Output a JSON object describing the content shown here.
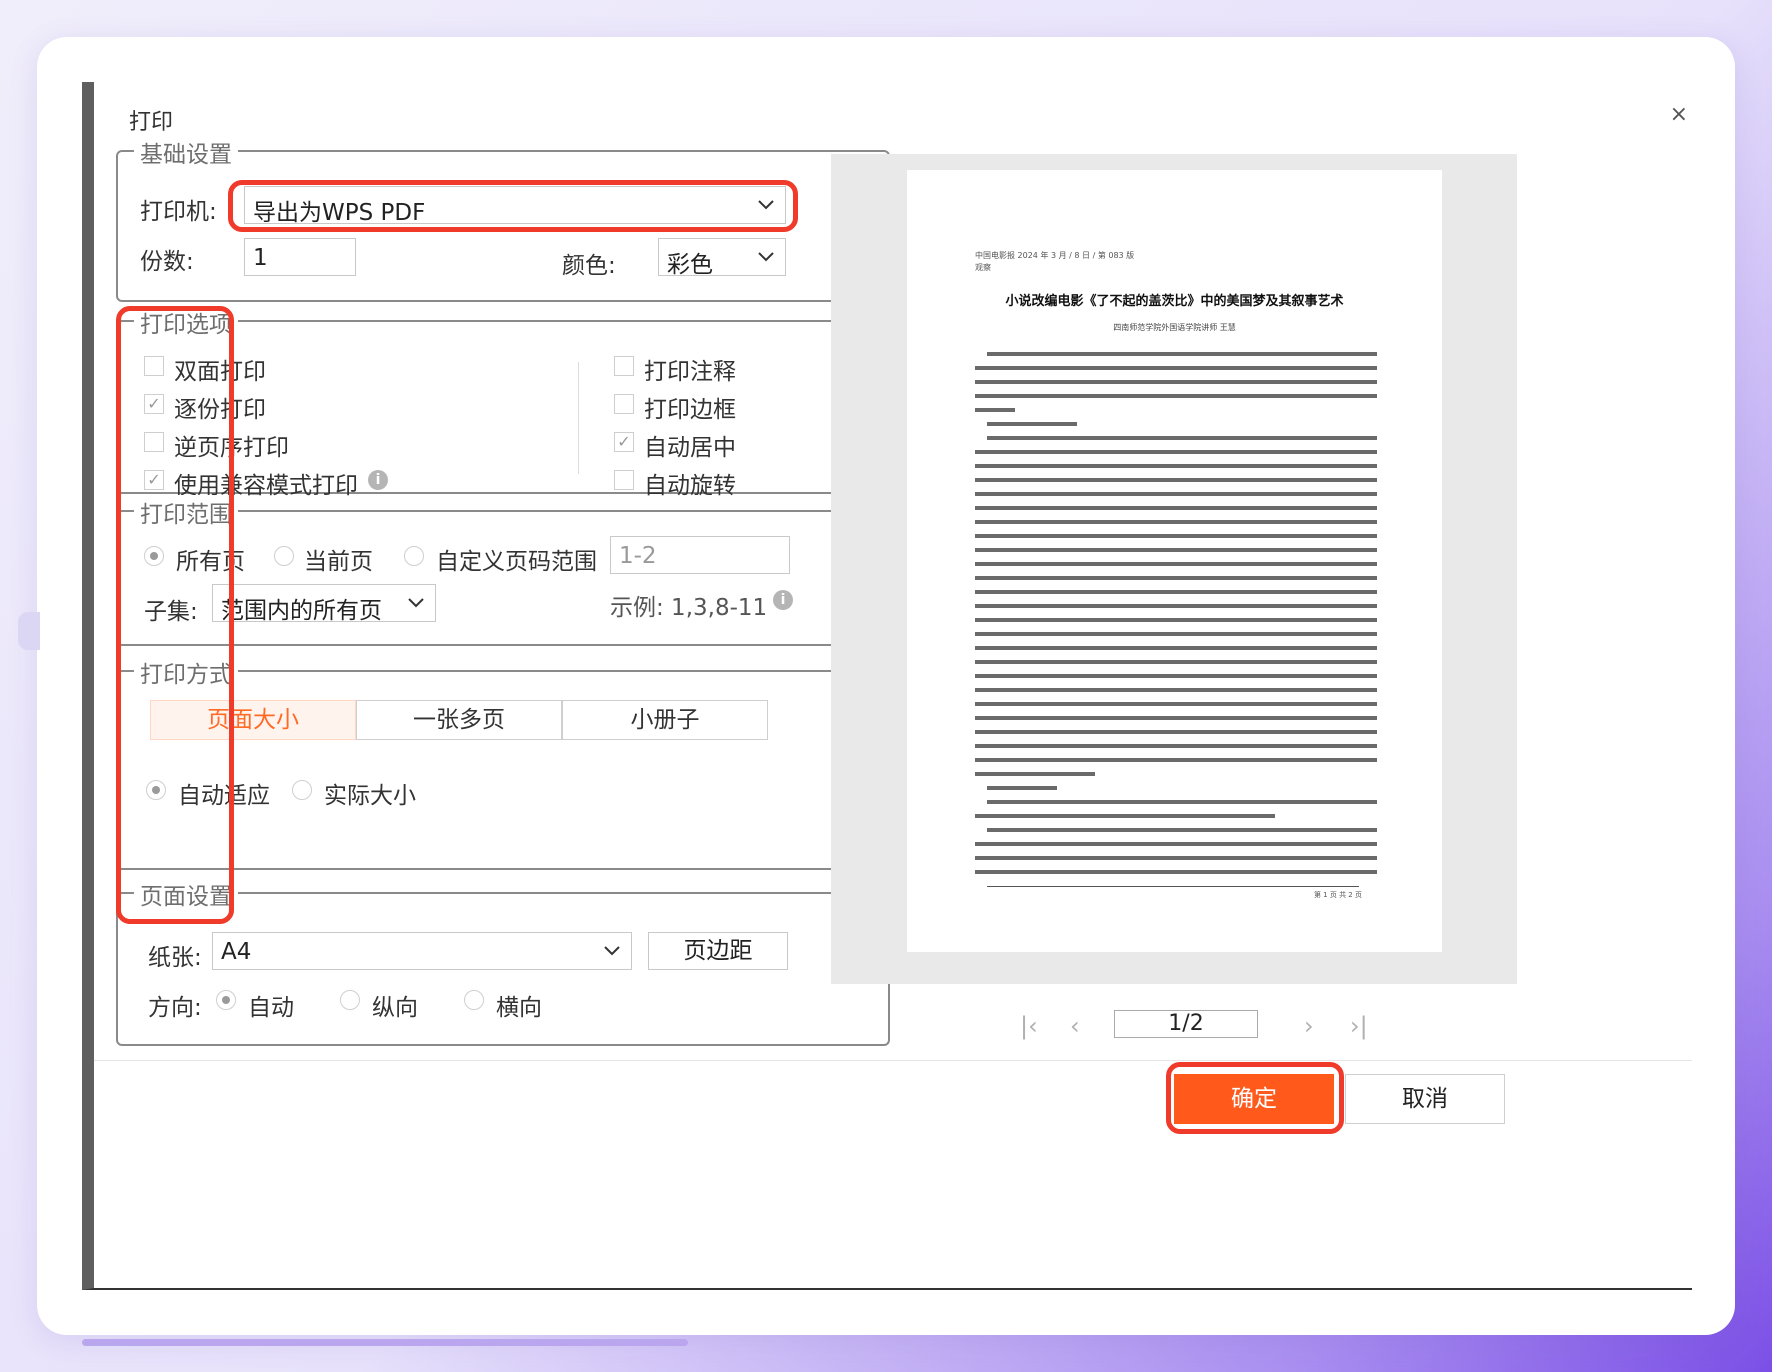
{
  "dialog": {
    "title": "打印",
    "close_symbol": "×"
  },
  "basic": {
    "legend": "基础设置",
    "printer_label": "打印机:",
    "printer_value": "导出为WPS PDF",
    "copies_label": "份数:",
    "copies_value": "1",
    "color_label": "颜色:",
    "color_value": "彩色"
  },
  "options": {
    "legend": "打印选项",
    "duplex": "双面打印",
    "collate": "逐份打印",
    "reverse": "逆页序打印",
    "compat": "使用兼容模式打印",
    "annot": "打印注释",
    "border": "打印边框",
    "center": "自动居中",
    "rotate": "自动旋转",
    "checked": {
      "duplex": false,
      "collate": true,
      "reverse": false,
      "compat": true,
      "annot": false,
      "border": false,
      "center": true,
      "rotate": false
    }
  },
  "range": {
    "legend": "打印范围",
    "all": "所有页",
    "current": "当前页",
    "custom": "自定义页码范围",
    "custom_placeholder": "1-2",
    "subset_label": "子集:",
    "subset_value": "范围内的所有页",
    "example": "示例: 1,3,8-11"
  },
  "method": {
    "legend": "打印方式",
    "tab_size": "页面大小",
    "tab_multi": "一张多页",
    "tab_booklet": "小册子",
    "fit": "自动适应",
    "actual": "实际大小"
  },
  "page_setup": {
    "legend": "页面设置",
    "paper_label": "纸张:",
    "paper_value": "A4",
    "margin_button": "页边距",
    "orient_label": "方向:",
    "auto": "自动",
    "portrait": "纵向",
    "landscape": "横向"
  },
  "preview": {
    "doc_header": "中国电影报 2024 年 3 月 / 8 日 / 第 083 版\n观察",
    "doc_title": "小说改编电影《了不起的盖茨比》中的美国梦及其叙事艺术",
    "doc_author": "四南师范学院外国语学院讲师 王慧",
    "doc_footer": "第 1 页  共 2 页",
    "page_indicator": "1/2"
  },
  "footer": {
    "ok": "确定",
    "cancel": "取消"
  },
  "colors": {
    "accent": "#ff5a1c",
    "highlight_box": "#f03a2a"
  },
  "icons": [
    "close-icon",
    "chevron-down-icon",
    "info-icon",
    "first-page-icon",
    "prev-page-icon",
    "next-page-icon",
    "last-page-icon"
  ]
}
